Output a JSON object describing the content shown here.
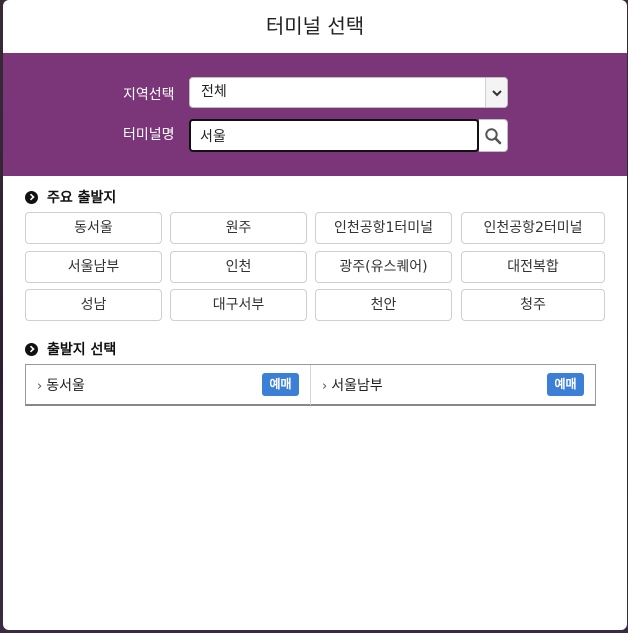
{
  "modal": {
    "title": "터미널 선택"
  },
  "filter": {
    "region_label": "지역선택",
    "region_value": "전체",
    "name_label": "터미널명",
    "name_value": "서울"
  },
  "main_departures": {
    "title": "주요 출발지",
    "items": [
      "동서울",
      "원주",
      "인천공항1터미널",
      "인천공항2터미널",
      "서울남부",
      "인천",
      "광주(유스퀘어)",
      "대전복합",
      "성남",
      "대구서부",
      "천안",
      "청주"
    ]
  },
  "choose_departure": {
    "title": "출발지 선택",
    "results": [
      {
        "name": "동서울",
        "action": "예매"
      },
      {
        "name": "서울남부",
        "action": "예매"
      }
    ]
  },
  "colors": {
    "panel": "#7b3579",
    "book_button": "#3b7fd6"
  },
  "icons": {
    "select_arrow": "chevron-down-icon",
    "search": "search-icon",
    "section_bullet": "chevron-right-circle-icon",
    "result_chevron": "chevron-right-icon"
  }
}
